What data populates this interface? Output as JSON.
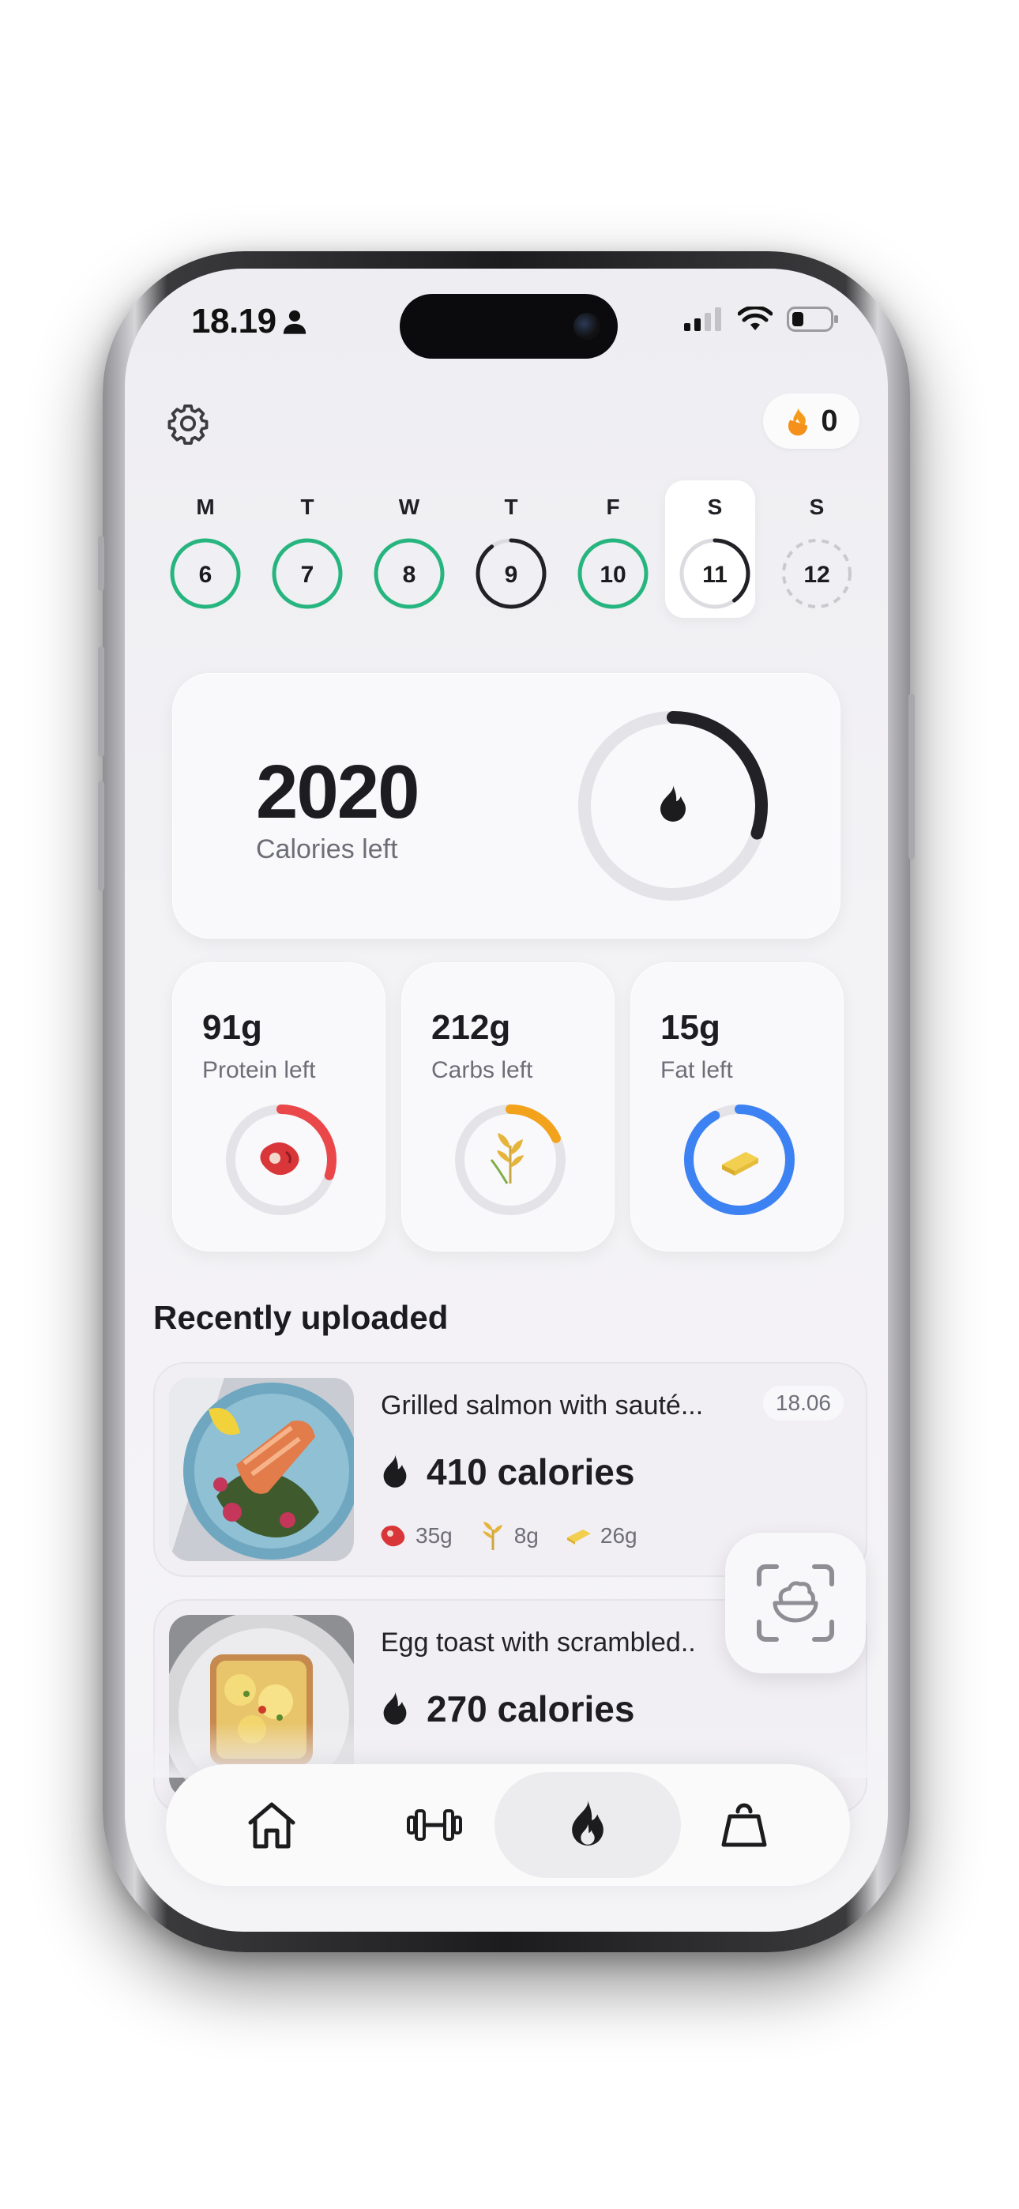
{
  "status_bar": {
    "time": "18.19"
  },
  "header": {
    "streak_count": "0"
  },
  "week": [
    {
      "letter": "M",
      "day": "6",
      "state": "complete",
      "progress": 1.0
    },
    {
      "letter": "T",
      "day": "7",
      "state": "complete",
      "progress": 1.0
    },
    {
      "letter": "W",
      "day": "8",
      "state": "complete",
      "progress": 1.0
    },
    {
      "letter": "T",
      "day": "9",
      "state": "partial",
      "progress": 0.9
    },
    {
      "letter": "F",
      "day": "10",
      "state": "complete",
      "progress": 1.0
    },
    {
      "letter": "S",
      "day": "11",
      "state": "today",
      "progress": 0.4
    },
    {
      "letter": "S",
      "day": "12",
      "state": "future",
      "progress": 0.0
    }
  ],
  "calories": {
    "value": "2020",
    "label": "Calories left",
    "progress": 0.3
  },
  "macros": [
    {
      "value": "91g",
      "label": "Protein left",
      "color": "#e9474a",
      "progress": 0.3,
      "icon": "steak-icon"
    },
    {
      "value": "212g",
      "label": "Carbs left",
      "color": "#f2a31b",
      "progress": 0.18,
      "icon": "wheat-icon"
    },
    {
      "value": "15g",
      "label": "Fat left",
      "color": "#3d82f2",
      "progress": 0.92,
      "icon": "butter-icon"
    }
  ],
  "recent": {
    "title": "Recently uploaded",
    "items": [
      {
        "name": "Grilled salmon with sauté...",
        "time": "18.06",
        "calories": "410 calories",
        "protein": "35g",
        "carbs": "8g",
        "fat": "26g"
      },
      {
        "name": "Egg toast with scrambled..",
        "calories": "270 calories"
      }
    ]
  },
  "colors": {
    "complete": "#27b57f",
    "partial": "#222226",
    "ring_track": "#e4e4e8",
    "accent_flame": "#f59a1b"
  }
}
